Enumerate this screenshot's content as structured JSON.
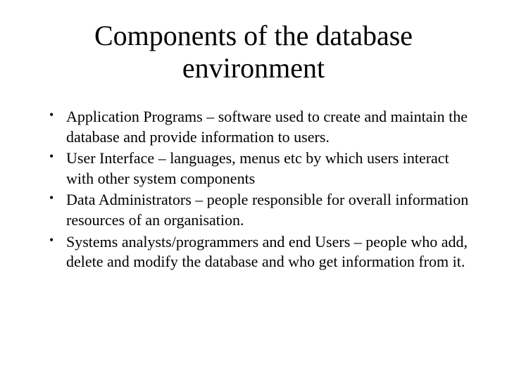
{
  "title": "Components of the database environment",
  "bullets": [
    "Application Programs – software used to create and maintain the database and provide information to users.",
    "User Interface – languages, menus etc by which users interact with other system components",
    "Data Administrators – people responsible for overall information resources of an organisation.",
    "Systems analysts/programmers and end Users – people who add, delete and modify the database and who get information from it."
  ]
}
